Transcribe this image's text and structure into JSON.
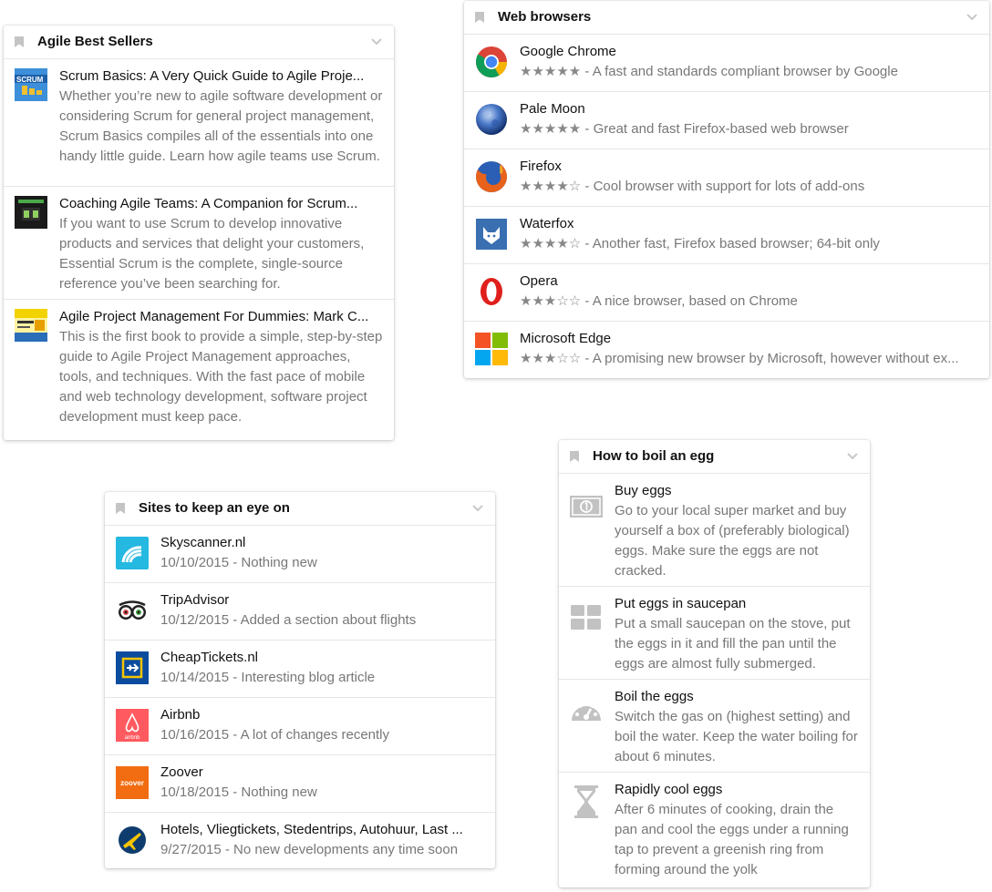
{
  "agile": {
    "title": "Agile Best Sellers",
    "items": [
      {
        "title": "Scrum Basics: A Very Quick Guide to Agile Proje...",
        "desc": "Whether you’re new to agile software development or considering Scrum for general project management, Scrum Basics compiles all of the essentials into one handy little guide. Learn how agile teams use Scrum.",
        "icon": "scrum-basics-book-cover",
        "cover_text": "SCRUM"
      },
      {
        "title": "Coaching Agile Teams: A Companion for Scrum...",
        "desc": "If you want to use Scrum to develop innovative products and services that delight your customers, Essential Scrum is the complete, single-source reference you’ve been searching for.",
        "icon": "coaching-agile-teams-book-cover"
      },
      {
        "title": "Agile Project Management For Dummies: Mark C...",
        "desc": "This is the first book to provide a simple, step-by-step guide to Agile Project Management approaches, tools, and techniques. With the fast pace of mobile and web technology development, software project development must keep pace.",
        "icon": "agile-for-dummies-book-cover"
      }
    ]
  },
  "browsers": {
    "title": "Web browsers",
    "items": [
      {
        "name": "Google Chrome",
        "stars": "★★★★★",
        "desc": " - A fast and standards compliant browser by Google",
        "rating": 5,
        "icon": "chrome-icon"
      },
      {
        "name": "Pale Moon",
        "stars": "★★★★★",
        "desc": " - Great and fast Firefox-based web browser",
        "rating": 5,
        "icon": "pale-moon-icon"
      },
      {
        "name": "Firefox",
        "stars": "★★★★☆",
        "desc": " - Cool browser with support for lots of add-ons",
        "rating": 4,
        "icon": "firefox-icon"
      },
      {
        "name": "Waterfox",
        "stars": "★★★★☆",
        "desc": " - Another fast, Firefox based browser; 64-bit only",
        "rating": 4,
        "icon": "waterfox-icon"
      },
      {
        "name": "Opera",
        "stars": "★★★☆☆",
        "desc": " - A nice browser, based on Chrome",
        "rating": 3,
        "icon": "opera-icon"
      },
      {
        "name": "Microsoft Edge",
        "stars": "★★★☆☆",
        "desc": " - A promising new browser by Microsoft, however without ex...",
        "rating": 3,
        "icon": "windows-icon"
      }
    ]
  },
  "sites": {
    "title": "Sites to keep an eye on",
    "items": [
      {
        "name": "Skyscanner.nl",
        "desc": "10/10/2015 - Nothing new",
        "icon": "skyscanner-icon"
      },
      {
        "name": "TripAdvisor",
        "desc": "10/12/2015 - Added a section about flights",
        "icon": "tripadvisor-owl-icon"
      },
      {
        "name": "CheapTickets.nl",
        "desc": "10/14/2015 - Interesting blog article",
        "icon": "cheaptickets-plane-icon"
      },
      {
        "name": "Airbnb",
        "desc": "10/16/2015 - A lot of changes recently",
        "icon": "airbnb-icon",
        "logo_text": "airbnb"
      },
      {
        "name": "Zoover",
        "desc": "10/18/2015 - Nothing new",
        "icon": "zoover-icon",
        "logo_text": "zoover"
      },
      {
        "name": "Hotels, Vliegtickets, Stedentrips, Autohuur, Last ...",
        "desc": "9/27/2015 - No new developments any time soon",
        "icon": "expedia-plane-icon"
      }
    ]
  },
  "egg": {
    "title": "How to boil an egg",
    "items": [
      {
        "name": "Buy eggs",
        "desc": "Go to your local super market and buy yourself a box of (preferably biological) eggs. Make sure the eggs are not cracked.",
        "icon": "money-bill-icon"
      },
      {
        "name": "Put eggs in saucepan",
        "desc": "Put a small saucepan on the stove, put the eggs in it and fill the pan until the eggs are almost fully submerged.",
        "icon": "grid-icon"
      },
      {
        "name": "Boil the eggs",
        "desc": "Switch the gas on (highest setting) and boil the water. Keep the water boiling for about 6 minutes.",
        "icon": "dashboard-gauge-icon"
      },
      {
        "name": "Rapidly cool eggs",
        "desc": "After 6 minutes of cooking, drain the pan and cool the eggs under a running tap to prevent a greenish ring from forming around the yolk",
        "icon": "hourglass-icon"
      }
    ]
  },
  "colors": {
    "star": "#888888",
    "muted_text": "#777777",
    "icon_grey": "#bbbbbb"
  }
}
